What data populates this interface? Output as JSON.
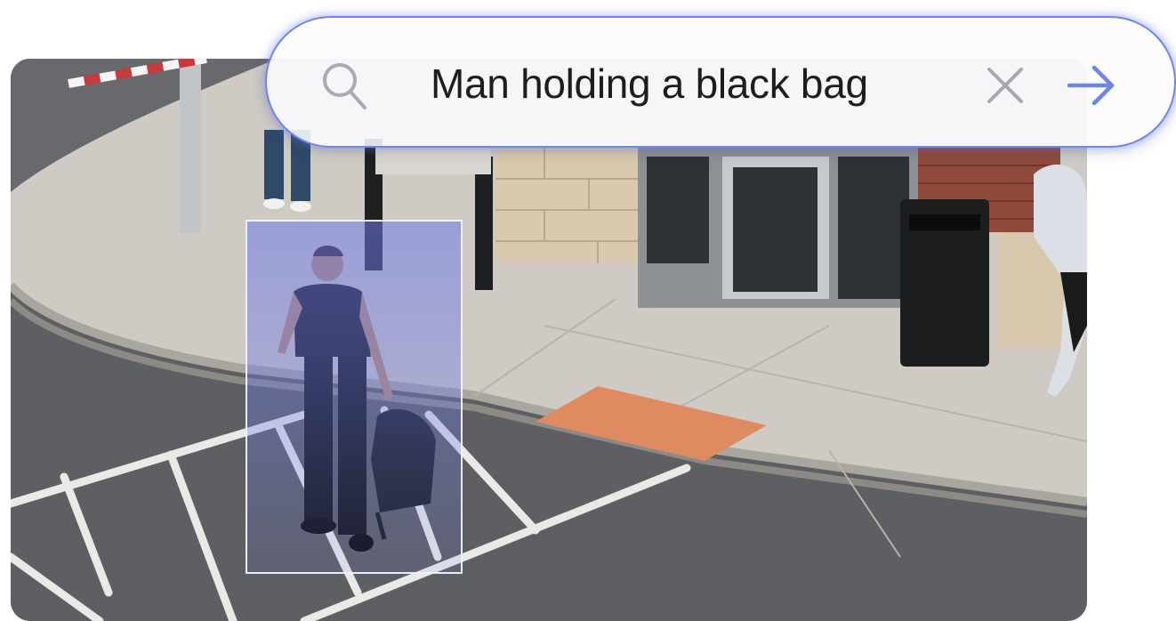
{
  "search": {
    "query": "Man holding a black bag",
    "search_icon": "search-icon",
    "clear_icon": "close-icon",
    "submit_icon": "arrow-right-icon"
  },
  "detection": {
    "match_label": "Man holding a black bag"
  },
  "colors": {
    "accent": "#6f86e8",
    "detection_fill": "#6e7ae6",
    "asphalt": "#5d5f63",
    "sidewalk": "#cfcbc4",
    "tactile_paving": "#e08a62"
  }
}
